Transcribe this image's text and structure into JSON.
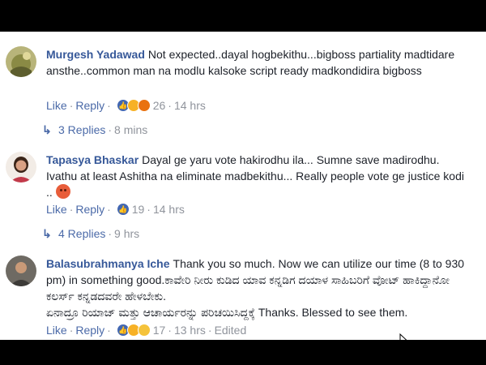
{
  "comments": [
    {
      "name": "Murgesh Yadawad",
      "text": "Not expected..dayal hogbekithu...bigboss partiality madtidare ansthe..common man na modlu kalsoke script ready madkondidira bigboss",
      "like": "Like",
      "reply": "Reply",
      "reaction_count": "26",
      "time": "14 hrs",
      "reactions": [
        "like-reaction-icon",
        "haha-reaction-icon",
        "angry-reaction-icon"
      ],
      "replies_label": "3 Replies",
      "replies_time": "8 mins"
    },
    {
      "name": "Tapasya Bhaskar",
      "text": "Dayal ge yaru vote hakirodhu ila... Sumne save madirodhu. Ivathu at least Ashitha na eliminate madbekithu... Really people vote ge justice kodi ..",
      "like": "Like",
      "reply": "Reply",
      "reaction_count": "19",
      "time": "14 hrs",
      "reactions": [
        "like-reaction-icon"
      ],
      "replies_label": "4 Replies",
      "replies_time": "9 hrs"
    },
    {
      "name": "Balasubrahmanya Iche",
      "text1": "Thank you so much. Now we can utilize our time (8 to 930 pm) in something good.ಕಾವೇರಿ ನೀರು ಕುಡಿದ ಯಾವ ಕನ್ನಡಿಗ ದಯಾಳ ಸಾಹಿಬರಿಗೆ ವೋಟ್ ಹಾಕಿದ್ದಾನೋ ಕಲರ್ಸ್ ಕನ್ನಡದವರೇ ಹೇಳಬೇಕು.",
      "text2": "ಏನಾದ್ರೂ ರಿಯಾಜ್ ಮತ್ತು ಆಚಾರ್ಯರನ್ನು ಪರಿಚಯಿಸಿದ್ದಕ್ಕೆ Thanks. Blessed to see them.",
      "like": "Like",
      "reply": "Reply",
      "reaction_count": "17",
      "time": "13 hrs",
      "edited": "Edited",
      "reactions": [
        "like-reaction-icon",
        "haha-reaction-icon",
        "sad-reaction-icon"
      ]
    }
  ],
  "colors": {
    "name": "#365899",
    "link": "#4b6aa8",
    "meta": "#90949c",
    "text": "#1d2129",
    "bars": "#000000"
  }
}
